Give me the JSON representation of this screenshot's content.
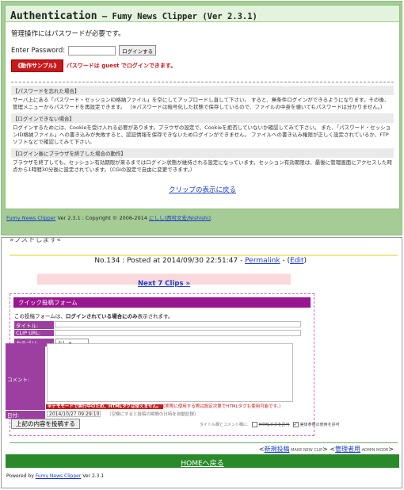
{
  "auth": {
    "title": "Authentication",
    "subtitle": " – Fumy News Clipper (Ver 2.3.1)",
    "required_message": "管理操作にはパスワードが必要です。",
    "password_label": "Enter Password:",
    "password_value": "",
    "login_button": "ログインする",
    "sample_badge": "《動作サンプル》",
    "sample_text": "パスワードは guest でログインできます。",
    "sections": [
      {
        "heading": "【パスワードを忘れた場合】",
        "text": "サーバ上にある「パスワード・セッションID格納ファイル」を空にしてアップロードし直して下さい。 すると、無条件ログインができるようになります。その後、管理メニューからパスワードを再設定できます。 （※パスワードは暗号化した状態で保存しているので、ファイルの中身を覗いてもパスワードは分かりません。）"
      },
      {
        "heading": "【ログインできない場合】",
        "text": "ログインするためには、Cookieを受け入れる必要があります。ブラウザの設定で、Cookieを拒否していないか確認してみて下さい。 また、「パスワード・セッションID格納ファイル」への書き込みが失敗すると、認証情報を保存できないためログインができません。 ファイルへの書き込み権限が正しく設定されているか、FTPソフトなどで確認してみて下さい。"
      },
      {
        "heading": "【ログイン後にブラウザを終了した場合の動作】",
        "text": "ブラウザを終了しても、セッション有効期限が来るまではログイン状態が維持される設定になっています。セッション有効期限は、最後に管理画面にアクセスした時点から1時間30分後に設定されています。（CGIの設定で自由に変更できます。）"
      }
    ],
    "back_link": "クリップの表示に戻る",
    "footer_app": "Fumy News Clipper",
    "footer_ver": " Ver 2.3.1 : Copyright © 2006-2014 ",
    "footer_author": "にしし(西村文宏/Nishishi)",
    "footer_end": "."
  },
  "page": {
    "partial_text": "»プストします«",
    "post_meta_prefix": "No.134 : Posted at 2014/09/30 22:51:47 - ",
    "permalink": "Permalink",
    "post_meta_mid": " - (",
    "edit": "Edit",
    "post_meta_end": ")",
    "next_clips": "Next 7 Clips »",
    "quick_form": {
      "heading": "クイック投稿フォーム",
      "note_pre": "この投稿フォームは、",
      "note_bold": "ログインされている場合にのみ",
      "note_post": "表示されます。",
      "title_label": "タイトル:",
      "url_label": "CLIP URL:",
      "category_label": "カテゴリ:",
      "category_value": "なし",
      "comment_label": "コメント:",
      "demo_warning": "※デモモードで実行中のため、HTMLタグは使えません。",
      "demo_note": "（実際に使用する際は設定次第でHTMLタグも使用可能です。）",
      "date_label": "日付:",
      "date_value": "2014/10/27 09:29:10",
      "date_hint": "（空欄にすると投稿の瞬間の日時を自動記録）",
      "submit": "上記の内容を投稿する",
      "opt_prefix": "タイトル欄とコメント欄に:",
      "opt1": "HTMLタグを許可",
      "opt2": "実体参照の使用を許可"
    },
    "nav": {
      "new_post": "新規投稿",
      "new_post_small": " MAKE NEW CLIP",
      "admin": "管理者用",
      "admin_small": " ADMIN MODE"
    },
    "home": "HOMEへ戻る",
    "footer_prefix": "Powered by ",
    "footer_app": "Fumy News Clipper",
    "footer_ver": " Ver 2.3.1"
  }
}
